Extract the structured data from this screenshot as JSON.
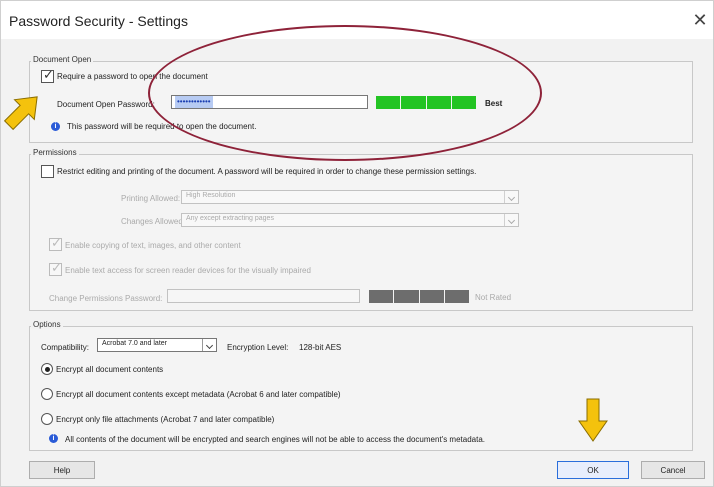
{
  "dialog": {
    "title": "Password Security - Settings",
    "close_glyph": "✕"
  },
  "document_open": {
    "group_label": "Document Open",
    "require_password_label": "Require a password to open the document",
    "require_password_checked": true,
    "password_label": "Document Open Password:",
    "password_value": "••••••••••••",
    "strength_text": "Best",
    "strength_color": "#23c423",
    "info_text": "This password will be required to open the document."
  },
  "permissions": {
    "group_label": "Permissions",
    "restrict_label": "Restrict editing and printing of the document. A password will be required in order to change these permission settings.",
    "restrict_checked": false,
    "printing_label": "Printing Allowed:",
    "printing_value": "High Resolution",
    "changes_label": "Changes Allowed:",
    "changes_value": "Any except extracting pages",
    "copy_label": "Enable copying of text, images, and other content",
    "copy_checked": true,
    "screen_reader_label": "Enable text access for screen reader devices for the visually impaired",
    "screen_reader_checked": true,
    "change_permissions_label": "Change Permissions Password:",
    "not_rated_text": "Not Rated"
  },
  "options": {
    "group_label": "Options",
    "compatibility_label": "Compatibility:",
    "compatibility_value": "Acrobat 7.0 and later",
    "encryption_level_label": "Encryption  Level:",
    "encryption_level_value": "128-bit AES",
    "radio_all_label": "Encrypt all document contents",
    "radio_except_metadata_label": "Encrypt all document contents except metadata (Acrobat 6 and later compatible)",
    "radio_attachments_label": "Encrypt only file attachments (Acrobat 7 and later compatible)",
    "selected_option": "all",
    "info_text": "All contents of the document will be encrypted and search engines will not be able to access the document's metadata."
  },
  "buttons": {
    "help": "Help",
    "ok": "OK",
    "cancel": "Cancel"
  },
  "annotations": {
    "arrow_color": "#f4c20d",
    "ellipse_color": "#8e2239"
  }
}
